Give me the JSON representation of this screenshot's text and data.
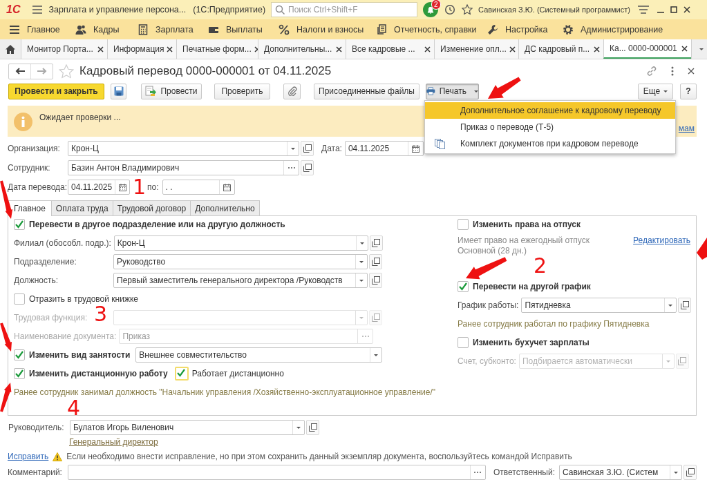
{
  "app_header": {
    "logo": "1С",
    "title": "Зарплата и управление персона...",
    "platform": "(1С:Предприятие)",
    "search": {
      "placeholder": "Поиск Ctrl+Shift+F"
    },
    "notification_count": "2",
    "user": "Савинская З.Ю. (Системный программист)"
  },
  "sections": [
    {
      "label": "Главное"
    },
    {
      "label": "Кадры"
    },
    {
      "label": "Зарплата"
    },
    {
      "label": "Выплаты"
    },
    {
      "label": "Налоги и взносы"
    },
    {
      "label": "Отчетность, справки"
    },
    {
      "label": "Настройка"
    },
    {
      "label": "Администрирование"
    }
  ],
  "open_tabs": [
    {
      "label": "Монитор Порта...",
      "selected": false
    },
    {
      "label": "Информация",
      "selected": false
    },
    {
      "label": "Печатные форм...",
      "selected": false
    },
    {
      "label": "Дополнительны...",
      "selected": false
    },
    {
      "label": "Все кадровые ...",
      "selected": false
    },
    {
      "label": "Изменение опл...",
      "selected": false
    },
    {
      "label": "ДС кадровый п...",
      "selected": false
    },
    {
      "label": "Ка... 0000-000001",
      "selected": true
    }
  ],
  "document": {
    "title": "Кадровый перевод 0000-000001 от 04.11.2025"
  },
  "toolbar": [
    {
      "kind": "primary",
      "label": "Провести и закрыть"
    },
    {
      "kind": "save"
    },
    {
      "kind": "post",
      "label": "Провести"
    },
    {
      "kind": "button",
      "label": "Проверить"
    },
    {
      "kind": "attach"
    },
    {
      "kind": "button",
      "label": "Присоединенные файлы"
    },
    {
      "kind": "print",
      "label": "Печать",
      "pressed": true
    },
    {
      "kind": "more",
      "label": "Еще"
    },
    {
      "kind": "help",
      "label": "?"
    }
  ],
  "message": {
    "text": "Ожидает проверки ...",
    "link": "мам"
  },
  "print_menu": {
    "items": [
      {
        "kind": "plain",
        "label": "Дополнительное соглашение к кадровому переводу",
        "selected": true
      },
      {
        "kind": "plain",
        "label": "Приказ о переводе (Т-5)",
        "selected": false
      },
      {
        "kind": "set",
        "label": "Комплект документов при кадровом переводе",
        "selected": false
      }
    ]
  },
  "header": {
    "organization": {
      "label": "Организация:",
      "value": "Крон-Ц"
    },
    "date": {
      "label": "Дата:",
      "value": "04.11.2025"
    },
    "employee": {
      "label": "Сотрудник:",
      "value": "Базин Антон Владимирович"
    },
    "transfer_date": {
      "label": "Дата перевода:",
      "value": "04.11.2025"
    },
    "until": {
      "label": "по:",
      "value": "  .  ."
    }
  },
  "form_tabs": [
    {
      "label": "Главное",
      "selected": true
    },
    {
      "label": "Оплата труда",
      "selected": false
    },
    {
      "label": "Трудовой договор",
      "selected": false
    },
    {
      "label": "Дополнительно",
      "selected": false
    }
  ],
  "left": [
    {
      "kind": "checkbox",
      "label": "Перевести в другое подразделение или на другую должность",
      "checked": true,
      "bold": true
    },
    {
      "kind": "select",
      "label": "Филиал (обособл. подр.):",
      "value": "Крон-Ц",
      "disabled": false
    },
    {
      "kind": "select",
      "label": "Подразделение:",
      "value": "Руководство",
      "disabled": false
    },
    {
      "kind": "select",
      "label": "Должность:",
      "value": "Первый заместитель генерального директора /Руководств",
      "disabled": false
    },
    {
      "kind": "checkbox",
      "label": "Отразить в трудовой книжке",
      "checked": false,
      "bold": false
    },
    {
      "kind": "select",
      "label": "Трудовая функция:",
      "disabled": true
    },
    {
      "kind": "dots",
      "label": "Наименование документа:",
      "value": "Приказ",
      "disabled": true
    },
    {
      "kind": "checkbox_select",
      "label": "Изменить вид занятости",
      "checked": true,
      "value": "Внешнее совместительство"
    },
    {
      "kind": "checkbox_pair",
      "label": "Изменить дистанционную работу",
      "checked": true,
      "second": {
        "label": "Работает дистанционно",
        "checked": true
      }
    },
    {
      "kind": "note",
      "text": "Ранее сотрудник занимал должность \"Начальник управления /Хозяйственно-эксплуатационное управление/\""
    }
  ],
  "right": [
    {
      "kind": "checkbox",
      "label": "Изменить права на отпуск",
      "checked": false,
      "bold": true
    },
    {
      "kind": "info_link",
      "text": "Имеет право на ежегодный отпуск Основной (28 дн.)",
      "link": "Редактировать"
    },
    {
      "kind": "checkbox",
      "label": "Перевести на другой график",
      "checked": true,
      "bold": true
    },
    {
      "kind": "select",
      "label": "График работы:",
      "value": "Пятидневка",
      "disabled": false
    },
    {
      "kind": "note",
      "text": "Ранее сотрудник работал по графику Пятидневка"
    },
    {
      "kind": "checkbox",
      "label": "Изменить бухучет зарплаты",
      "checked": false,
      "bold": true
    },
    {
      "kind": "select",
      "label": "Счет, субконто:",
      "placeholder": "Подбирается автоматически",
      "disabled": true
    }
  ],
  "manager": {
    "label": "Руководитель:",
    "value": "Булатов Игорь Виленович",
    "position": "Генеральный директор"
  },
  "correction": {
    "link": "Исправить",
    "text": "Если необходимо внести исправление, но при этом сохранить данный экземпляр документа, воспользуйтесь командой Исправить"
  },
  "comment": {
    "label": "Комментарий:"
  },
  "responsible": {
    "label": "Ответственный:",
    "value": "Савинская З.Ю. (Систем"
  },
  "annotations": [
    {
      "label": "1"
    },
    {
      "label": "2"
    },
    {
      "label": "3"
    },
    {
      "label": "4"
    }
  ]
}
